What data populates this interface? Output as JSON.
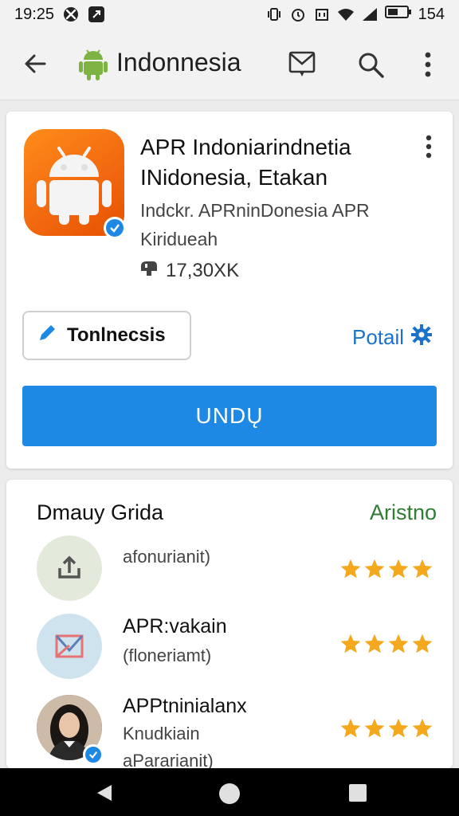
{
  "status": {
    "time": "19:25",
    "battery": "154",
    "left_icons": [
      "xbox-icon",
      "app-notification-icon"
    ],
    "right_icons": [
      "vibrate-icon",
      "alarm-icon",
      "nfc-icon",
      "wifi-icon",
      "signal-icon"
    ]
  },
  "appbar": {
    "title": "Indonnesia",
    "back_icon": "arrow-back-icon",
    "logo_icon": "android-icon",
    "actions": [
      "message-icon",
      "search-icon",
      "more-vert-icon"
    ]
  },
  "app": {
    "title_line1": "APR Indoniarindnetia",
    "title_line2": "INidonesia, Etakan",
    "sub_line1": "Indckr. APRninDonesia APR",
    "sub_line2": "Kiriduеah",
    "downloads": "17,30XK",
    "secondary_button": "Tonlnecsis",
    "detail_link": "Potail",
    "primary_button": "UNDŲ",
    "accent": "#1e88e5",
    "icon_color": "#f26a10"
  },
  "section": {
    "title": "Dmauy Grida",
    "link": "Aristno",
    "link_color": "#2e7d32",
    "items": [
      {
        "name": "",
        "meta": "afonurianit)",
        "rating": 4,
        "icon": "upload-icon"
      },
      {
        "name": "APR:vakain",
        "meta": "(floneriamt)",
        "rating": 4,
        "icon": "envelope-icon"
      },
      {
        "name": "APPtninialanx",
        "meta": "Knudkiain",
        "meta2": "aPararianit)",
        "rating": 4,
        "icon": "person-avatar"
      }
    ]
  }
}
